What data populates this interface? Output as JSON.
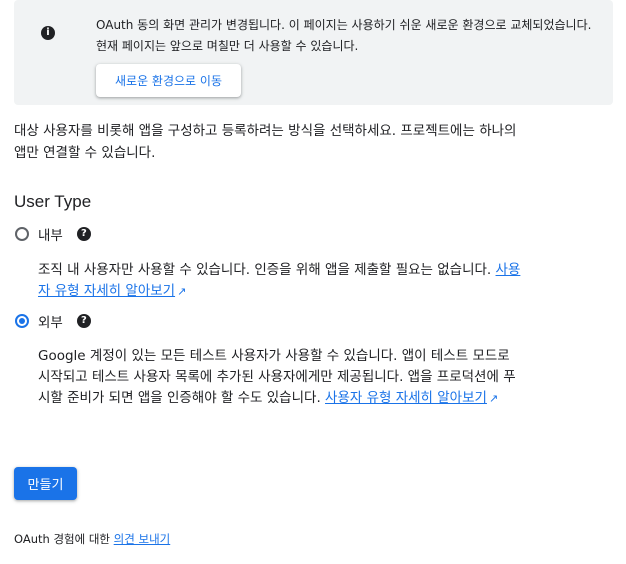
{
  "banner": {
    "icon": "info-icon",
    "text": "OAuth 동의 화면 관리가 변경됩니다. 이 페이지는 사용하기 쉬운 새로운 환경으로 교체되었습니다. 현재 페이지는 앞으로 며칠만 더 사용할 수 있습니다.",
    "button_label": "새로운 환경으로 이동"
  },
  "intro": "대상 사용자를 비롯해 앱을 구성하고 등록하려는 방식을 선택하세요. 프로젝트에는 하나의 앱만 연결할 수 있습니다.",
  "user_type": {
    "title": "User Type",
    "options": [
      {
        "label": "내부",
        "selected": false,
        "description": "조직 내 사용자만 사용할 수 있습니다. 인증을 위해 앱을 제출할 필요는 없습니다.",
        "link": "사용자 유형 자세히 알아보기"
      },
      {
        "label": "외부",
        "selected": true,
        "description": "Google 계정이 있는 모든 테스트 사용자가 사용할 수 있습니다. 앱이 테스트 모드로 시작되고 테스트 사용자 목록에 추가된 사용자에게만 제공됩니다. 앱을 프로덕션에 푸시할 준비가 되면 앱을 인증해야 할 수도 있습니다.",
        "link": "사용자 유형 자세히 알아보기"
      }
    ]
  },
  "create_button_label": "만들기",
  "feedback": {
    "text": "OAuth 경험에 대한",
    "link": "의견 보내기"
  },
  "colors": {
    "accent": "#1a73e8",
    "banner_bg": "#f1f3f4",
    "text": "#202124"
  }
}
